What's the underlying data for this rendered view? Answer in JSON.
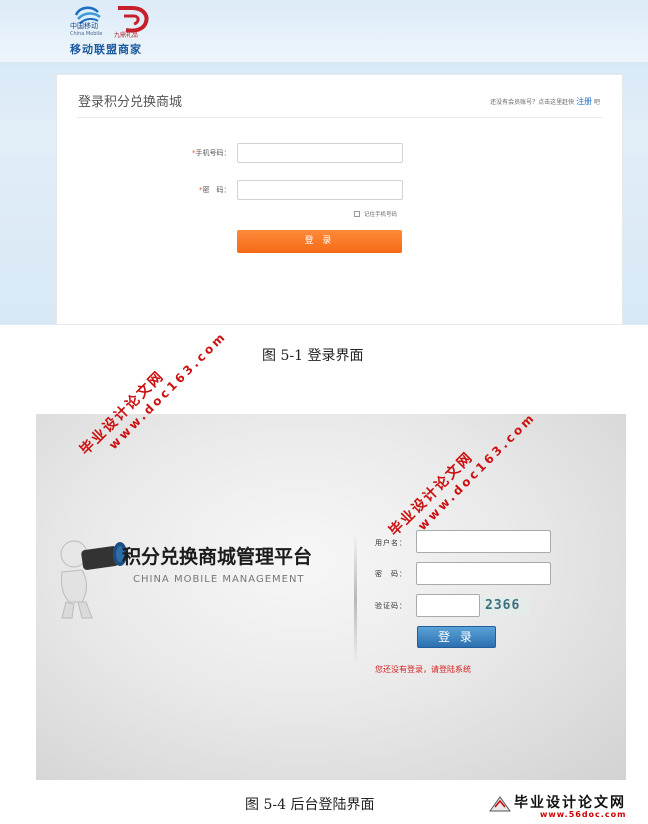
{
  "figure1": {
    "logo_cn": "中国移动",
    "logo_en": "China Mobile",
    "logo_d_text": "九鼎礼品",
    "merchant_label": "移动联盟商家",
    "card_title": "登录积分兑换商城",
    "register_prompt": "还没有会员账号？点击这里赶快",
    "register_link": "注册",
    "register_suffix": "吧",
    "phone_label": "手机号码：",
    "password_label": "密　码：",
    "remember_label": "记住手机号码",
    "login_button": "登 录",
    "caption": "图  5-1  登录界面"
  },
  "figure4": {
    "platform_title": "积分兑换商城管理平台",
    "platform_subtitle": "CHINA MOBILE MANAGEMENT",
    "username_label": "用户名：",
    "password_label": "密　码：",
    "captcha_label": "验证码：",
    "captcha_value": "2366",
    "login_button": "登 录",
    "error_message": "您还没有登录，请登陆系统",
    "caption": "图  5-4  后台登陆界面"
  },
  "watermark": {
    "cn": "毕业设计论文网",
    "url": "www.doc163.com"
  },
  "footer": {
    "cn": "毕业设计论文网",
    "url": "www.56doc.com"
  },
  "colors": {
    "accent_orange": "#f46a16",
    "accent_blue": "#2c6fb0",
    "error_red": "#d42020",
    "watermark_red": "#cc1010"
  }
}
